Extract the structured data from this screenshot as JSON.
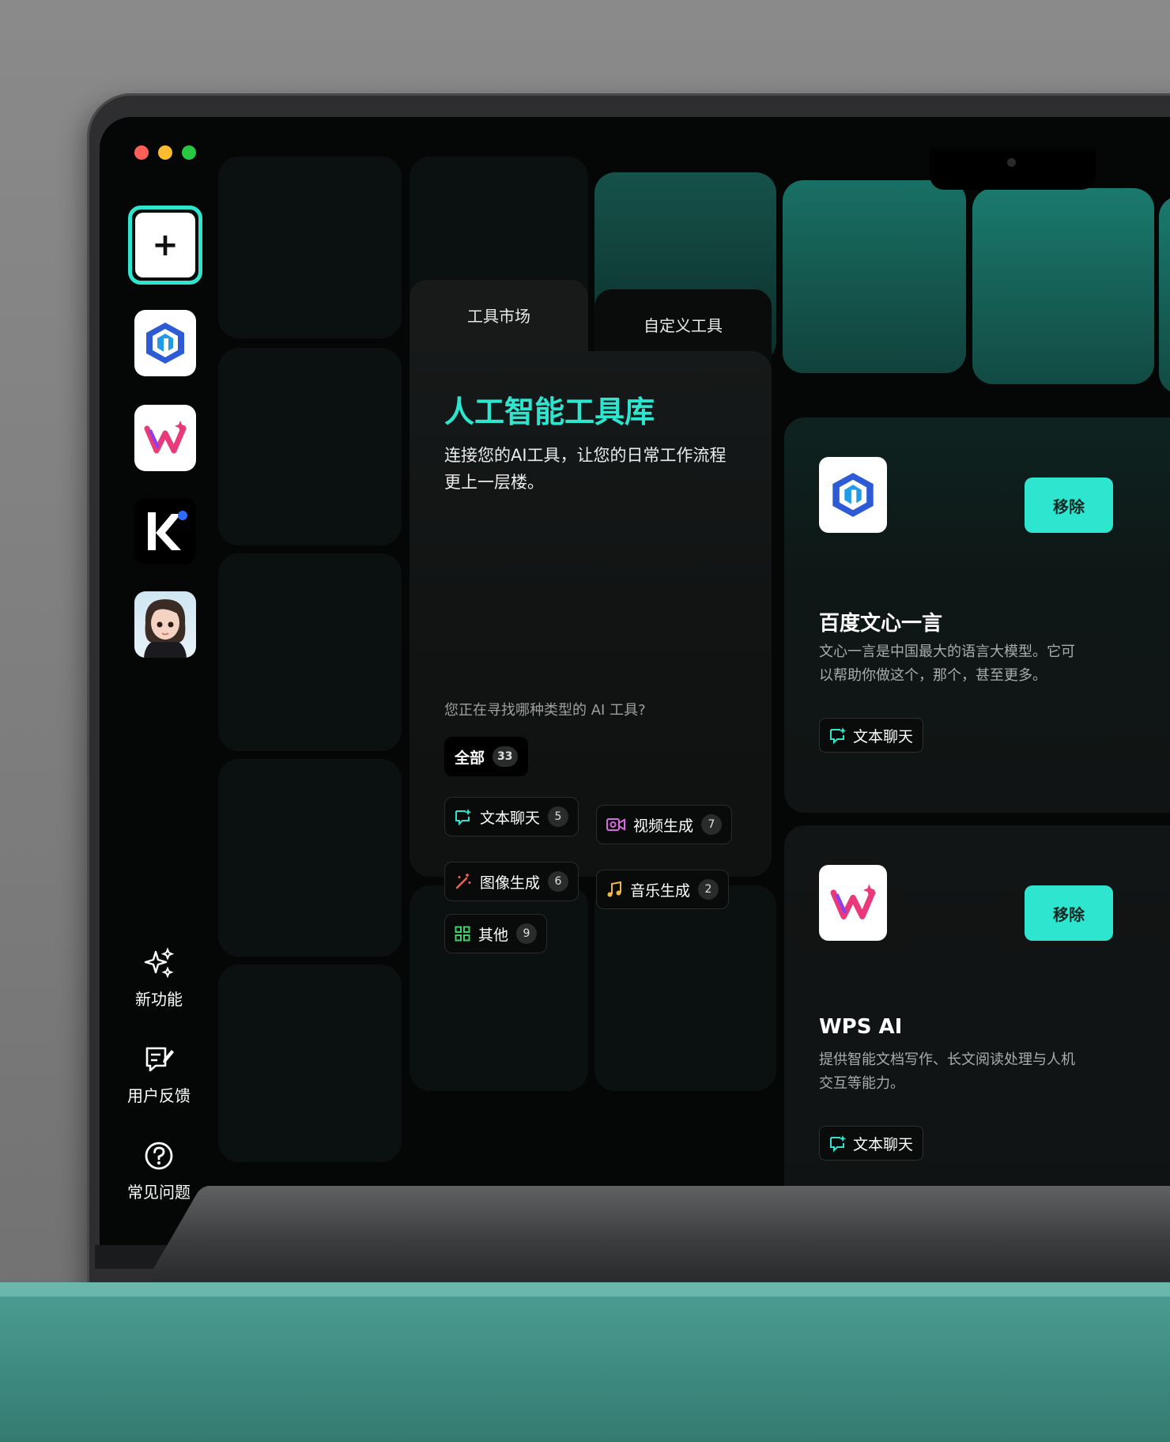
{
  "window": {
    "controls": [
      "close",
      "minimize",
      "maximize"
    ]
  },
  "sidebar": {
    "add_label": "+",
    "apps": [
      {
        "icon": "wenxin-logo-icon"
      },
      {
        "icon": "wps-ai-logo-icon"
      },
      {
        "icon": "k-app-logo-icon",
        "letter": "K"
      },
      {
        "icon": "avatar-icon"
      }
    ],
    "actions": [
      {
        "icon": "sparkle-icon",
        "label": "新功能"
      },
      {
        "icon": "feedback-icon",
        "label": "用户反馈"
      },
      {
        "icon": "help-circle-icon",
        "label": "常见问题"
      }
    ]
  },
  "tabs": [
    {
      "label": "工具市场",
      "active": true
    },
    {
      "label": "自定义工具",
      "active": false
    }
  ],
  "main": {
    "title": "人工智能工具库",
    "subtitle": "连接您的AI工具，让您的日常工作流程更上一层楼。",
    "question": "您正在寻找哪种类型的 AI 工具?",
    "categories": [
      {
        "label": "全部",
        "count": "33",
        "icon": ""
      },
      {
        "label": "文本聊天",
        "count": "5",
        "icon": "chat-sparkle-icon",
        "color": "#2ee6cf"
      },
      {
        "label": "视频生成",
        "count": "7",
        "icon": "video-icon",
        "color": "#d46be0"
      },
      {
        "label": "图像生成",
        "count": "6",
        "icon": "magic-wand-icon",
        "color": "#f0604d"
      },
      {
        "label": "音乐生成",
        "count": "2",
        "icon": "music-note-icon",
        "color": "#f5b73b"
      },
      {
        "label": "其他",
        "count": "9",
        "icon": "grid-icon",
        "color": "#3fd06a"
      }
    ]
  },
  "tools": [
    {
      "name": "百度文心一言",
      "description": "文心一言是中国最大的语言大模型。它可以帮助你做这个，那个，甚至更多。",
      "tag": "文本聊天",
      "action": "移除"
    },
    {
      "name": "WPS AI",
      "description": "提供智能文档写作、长文阅读处理与人机交互等能力。",
      "tag": "文本聊天",
      "action": "移除"
    }
  ],
  "colors": {
    "accent": "#2ee6cf",
    "background": "#050606",
    "panel": "#141717"
  }
}
